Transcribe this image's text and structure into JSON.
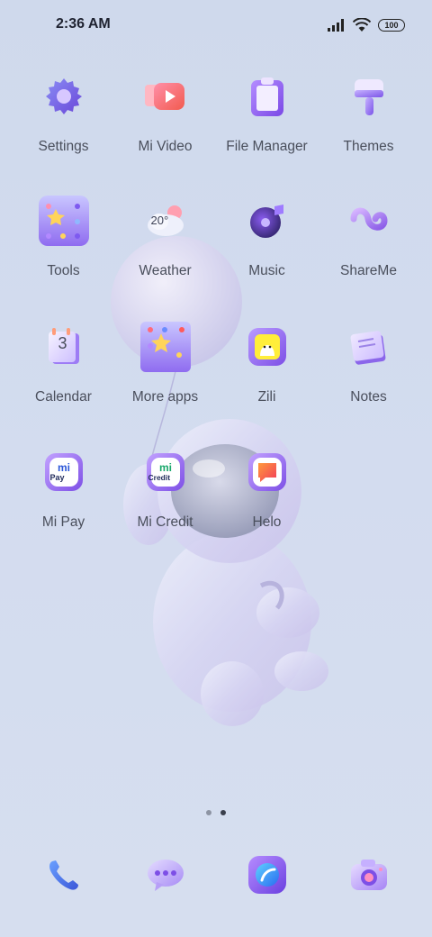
{
  "status_bar": {
    "time": "2:36 AM",
    "battery": "100",
    "icons": [
      "signal-icon",
      "wifi-icon",
      "battery-icon"
    ]
  },
  "home": {
    "apps": [
      {
        "label": "Settings",
        "icon": "settings-icon"
      },
      {
        "label": "Mi Video",
        "icon": "mi-video-icon"
      },
      {
        "label": "File Manager",
        "icon": "file-manager-icon"
      },
      {
        "label": "Themes",
        "icon": "themes-icon"
      },
      {
        "label": "Tools",
        "icon": "tools-folder-icon"
      },
      {
        "label": "Weather",
        "icon": "weather-icon",
        "temp": "20°"
      },
      {
        "label": "Music",
        "icon": "music-icon"
      },
      {
        "label": "ShareMe",
        "icon": "shareme-icon"
      },
      {
        "label": "Calendar",
        "icon": "calendar-icon",
        "day": "3"
      },
      {
        "label": "More apps",
        "icon": "more-apps-folder-icon"
      },
      {
        "label": "Zili",
        "icon": "zili-icon"
      },
      {
        "label": "Notes",
        "icon": "notes-icon"
      },
      {
        "label": "Mi Pay",
        "icon": "mi-pay-icon",
        "badge": "Pay"
      },
      {
        "label": "Mi Credit",
        "icon": "mi-credit-icon",
        "badge": "Credit"
      },
      {
        "label": "Helo",
        "icon": "helo-icon"
      }
    ],
    "page_indicator": {
      "pages": 2,
      "current": 2
    }
  },
  "dock": [
    {
      "icon": "phone-icon"
    },
    {
      "icon": "messages-icon"
    },
    {
      "icon": "browser-icon"
    },
    {
      "icon": "camera-icon"
    }
  ],
  "colors": {
    "accent_purple": "#8a5cf0",
    "background": "#d3dcef"
  }
}
